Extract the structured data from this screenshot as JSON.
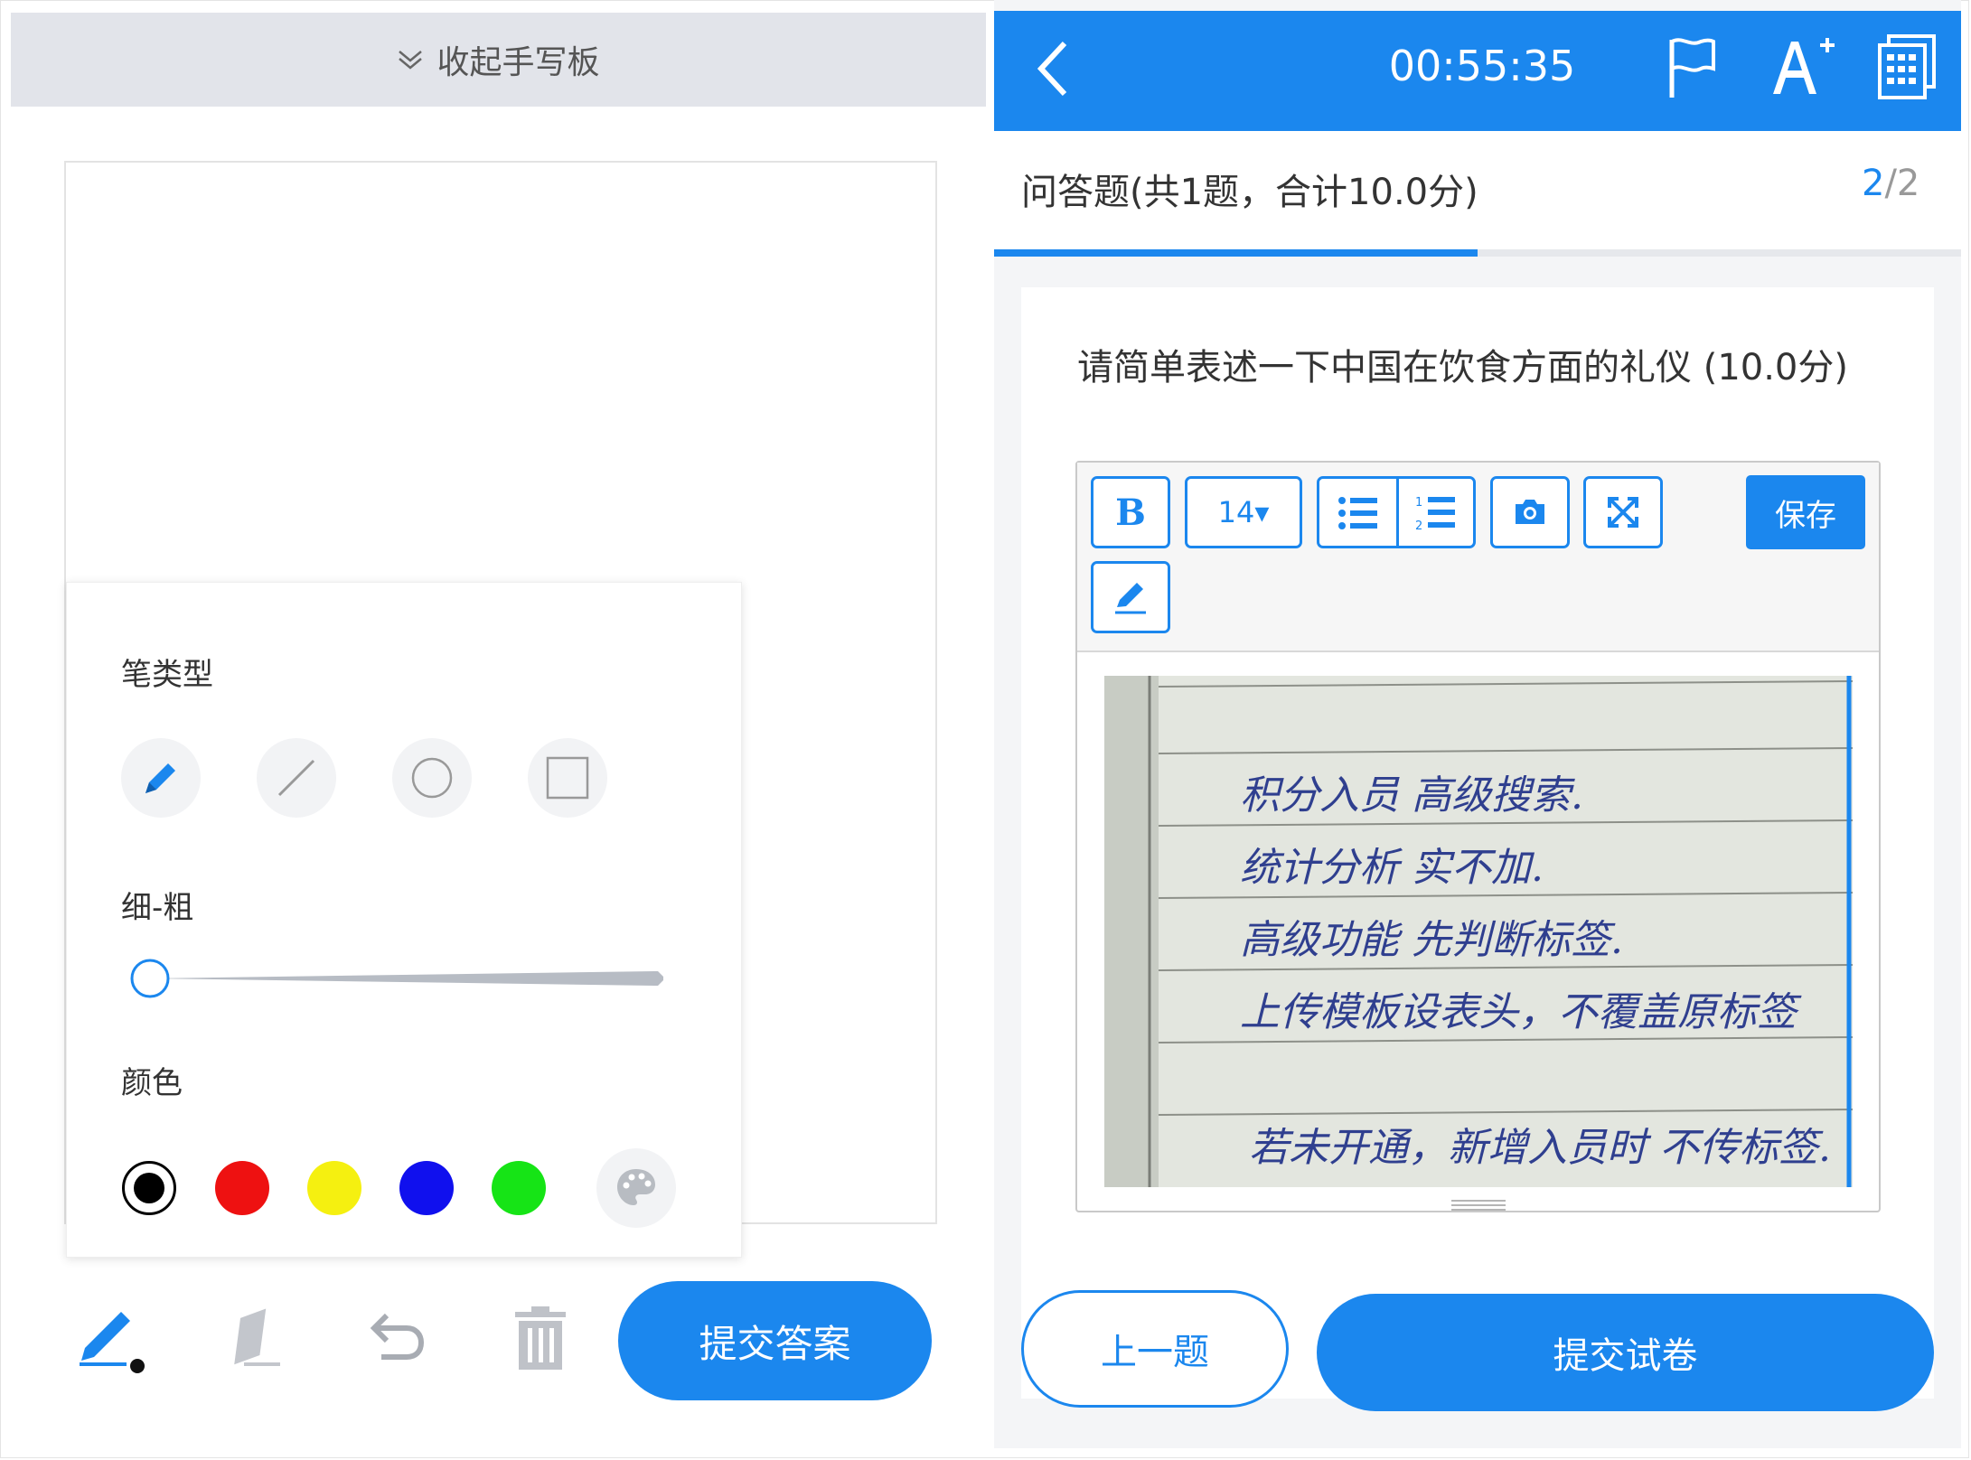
{
  "left_panel": {
    "collapse_label": "收起手写板",
    "pen_settings": {
      "pen_type_label": "笔类型",
      "pen_types": [
        "pencil-icon",
        "line-icon",
        "circle-icon",
        "rectangle-icon"
      ],
      "thickness_label": "细-粗",
      "thickness_value": 0,
      "color_label": "颜色",
      "colors": [
        "#000000",
        "#ee1111",
        "#f5f010",
        "#1010ee",
        "#16e416"
      ],
      "selected_color": "#000000"
    },
    "tools": [
      "pen-icon",
      "eraser-icon",
      "undo-icon",
      "trash-icon"
    ],
    "submit_label": "提交答案"
  },
  "right_panel": {
    "timer": "00:55:35",
    "header_icons": [
      "back-icon",
      "flag-icon",
      "font-size-icon",
      "answer-sheet-icon"
    ],
    "section_title": "问答题(共1题，合计10.0分)",
    "progress": {
      "current": "2",
      "sep_total": "/2",
      "fraction": 0.5
    },
    "question": "请简单表述一下中国在饮食方面的礼仪 (10.0分)",
    "editor": {
      "bold_label": "B",
      "font_size_label": "14▾",
      "save_label": "保存"
    },
    "handwriting_lines": [
      "积分入员 高级搜索.",
      "统计分析 实不加.",
      "高级功能 先判断标签.",
      "上传模板设表头，不覆盖原标签",
      "若未开通，新增入员时 不传标签."
    ],
    "prev_label": "上一题",
    "submit_label": "提交试卷"
  },
  "colors": {
    "accent": "#1b87ee",
    "header_gray": "#e2e4ea"
  }
}
